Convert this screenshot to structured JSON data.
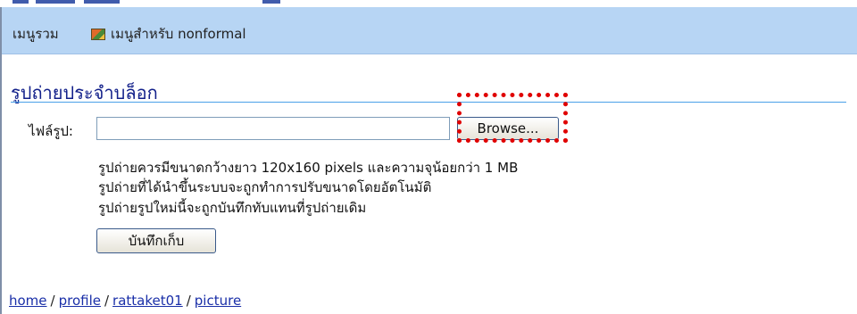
{
  "menu": {
    "all_label": "เมนูรวม",
    "nonformal_label": "เมนูสำหรับ nonformal",
    "nonformal_icon": "picture-icon"
  },
  "section": {
    "title": "รูปถ่ายประจำบล็อก"
  },
  "form": {
    "file_label": "ไฟล์รูป:",
    "file_value": "",
    "browse_label": "Browse...",
    "help_lines": [
      "รูปถ่ายควรมีขนาดกว้างยาว 120x160 pixels และความจุน้อยกว่า 1 MB",
      "รูปถ่ายที่ได้นำขึ้นระบบจะถูกทำการปรับขนาดโดยอัตโนมัติ",
      "รูปถ่ายรูปใหม่นี้จะถูกบันทึกทับแทนที่รูปถ่ายเดิม"
    ],
    "save_label": "บันทึกเก็บ"
  },
  "breadcrumb": {
    "items": [
      "home",
      "profile",
      "rattaket01",
      "picture"
    ],
    "separator": "/"
  },
  "colors": {
    "menubar": "#b7d5f4",
    "title": "#12208a",
    "link": "#1a2fa8",
    "highlight": "#e00000"
  }
}
